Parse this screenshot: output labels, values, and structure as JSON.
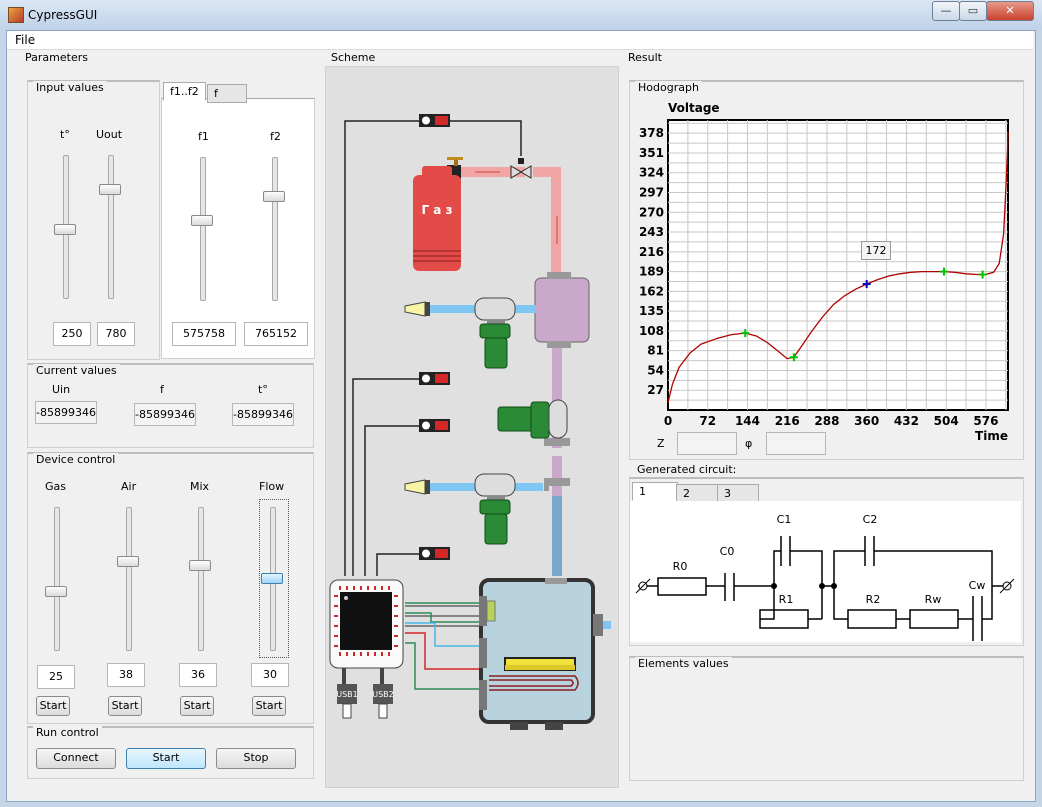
{
  "window": {
    "title": "CypressGUI",
    "controls": [
      "—",
      "▭",
      "✕"
    ]
  },
  "menu": {
    "file": "File"
  },
  "parameters": {
    "title": "Parameters",
    "input_values": {
      "title": "Input values",
      "t_label": "t°",
      "u_label": "Uout",
      "t_value": "250",
      "u_value": "780",
      "t_level": 0.48,
      "u_level": 0.78
    },
    "freq": {
      "tabs": [
        "f1..f2",
        "f"
      ],
      "f1_label": "f1",
      "f2_label": "f2",
      "f1_value": "575758",
      "f2_value": "765152",
      "f1_level": 0.56,
      "f2_level": 0.74
    },
    "current_values": {
      "title": "Current values",
      "uin_label": "Uin",
      "f_label": "f",
      "t_label": "t°",
      "uin_value": "-85899346",
      "f_value": "-85899346",
      "t_value": "-85899346"
    },
    "device_control": {
      "title": "Device control",
      "channels": [
        {
          "label": "Gas",
          "value": "25",
          "start": "Start",
          "level": 0.25
        },
        {
          "label": "Air",
          "value": "38",
          "start": "Start",
          "level": 0.38
        },
        {
          "label": "Mix",
          "value": "36",
          "start": "Start",
          "level": 0.36
        },
        {
          "label": "Flow",
          "value": "30",
          "start": "Start",
          "level": 0.3
        }
      ]
    },
    "run_control": {
      "title": "Run control",
      "connect": "Connect",
      "start": "Start",
      "stop": "Stop"
    }
  },
  "scheme": {
    "title": "Scheme",
    "tank_label": "Г а з",
    "usb1": "USB1",
    "usb2": "USB2"
  },
  "result": {
    "title": "Result",
    "hodograph": {
      "title": "Hodograph",
      "z_label": "Z",
      "phi_label": "φ",
      "z_value": "",
      "phi_value": ""
    },
    "tooltip": "172",
    "circuit": {
      "title": "Generated circuit:",
      "tabs": [
        "1",
        "2",
        "3"
      ],
      "labels": {
        "r0": "R0",
        "c0": "C0",
        "c1": "C1",
        "r1": "R1",
        "c2": "C2",
        "r2": "R2",
        "rw": "Rw",
        "cw": "Cw"
      }
    },
    "elements_values": {
      "title": "Elements values"
    }
  },
  "chart_data": {
    "type": "line",
    "ylabel": "Voltage",
    "xlabel": "Time",
    "xlim": [
      0,
      616
    ],
    "ylim": [
      0,
      396
    ],
    "x_ticks": [
      0,
      72,
      144,
      216,
      288,
      360,
      432,
      504,
      576
    ],
    "y_ticks": [
      27,
      54,
      81,
      108,
      135,
      162,
      189,
      216,
      243,
      270,
      297,
      324,
      351,
      378
    ],
    "grid": true,
    "line_color": "#b00000",
    "series": [
      {
        "points": [
          [
            0,
            10
          ],
          [
            8,
            35
          ],
          [
            20,
            58
          ],
          [
            40,
            78
          ],
          [
            60,
            90
          ],
          [
            90,
            98
          ],
          [
            115,
            103
          ],
          [
            140,
            105
          ],
          [
            160,
            101
          ],
          [
            180,
            92
          ],
          [
            200,
            80
          ],
          [
            216,
            70
          ],
          [
            228,
            72
          ],
          [
            240,
            85
          ],
          [
            260,
            107
          ],
          [
            280,
            127
          ],
          [
            300,
            144
          ],
          [
            320,
            156
          ],
          [
            340,
            165
          ],
          [
            360,
            172
          ],
          [
            380,
            178
          ],
          [
            400,
            183
          ],
          [
            420,
            186
          ],
          [
            440,
            188
          ],
          [
            460,
            189
          ],
          [
            480,
            189
          ],
          [
            500,
            189
          ],
          [
            520,
            188
          ],
          [
            540,
            186
          ],
          [
            560,
            185
          ],
          [
            575,
            185
          ],
          [
            590,
            188
          ],
          [
            600,
            200
          ],
          [
            608,
            240
          ],
          [
            612,
            300
          ],
          [
            615,
            350
          ],
          [
            616,
            380
          ]
        ]
      }
    ],
    "markers": [
      {
        "x": 140,
        "y": 105,
        "color": "#00c000"
      },
      {
        "x": 228,
        "y": 72,
        "color": "#00c000"
      },
      {
        "x": 360,
        "y": 172,
        "color": "#0000c0"
      },
      {
        "x": 500,
        "y": 189,
        "color": "#00c000"
      },
      {
        "x": 570,
        "y": 185,
        "color": "#00c000"
      }
    ]
  }
}
